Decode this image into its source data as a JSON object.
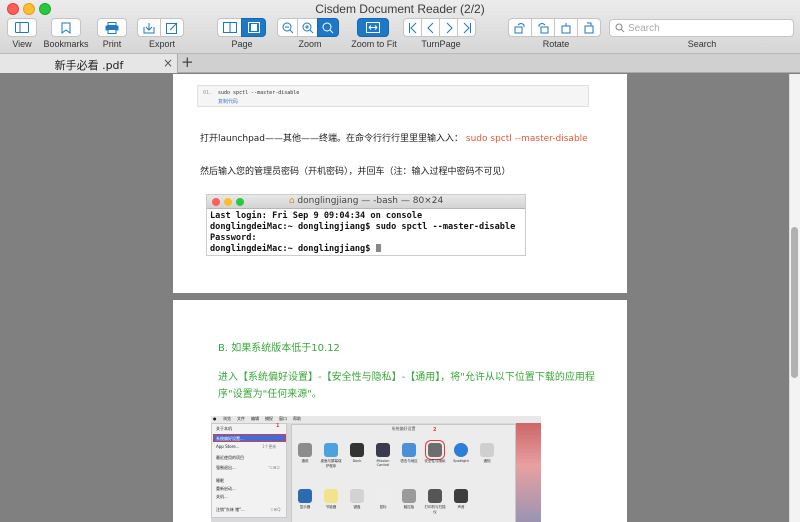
{
  "window": {
    "title": "Cisdem Document Reader (2/2)"
  },
  "toolbar": {
    "view": "View",
    "bookmarks": "Bookmarks",
    "print": "Print",
    "export": "Export",
    "page": "Page",
    "zoom": "Zoom",
    "zoom_to_fit": "Zoom to Fit",
    "turn_page": "TurnPage",
    "rotate": "Rotate",
    "search": "Search",
    "search_placeholder": "Search"
  },
  "tab": {
    "title": "新手必看 .pdf",
    "close": "×",
    "add": "+"
  },
  "page1": {
    "code_num": "01.",
    "code_text": "sudo spctl --master-disable",
    "code_copy": "复制代码",
    "line1_text": "打开launchpad——其他——终端。在命令行行行里里里输入入：",
    "line1_cmd": "sudo spctl --master-disable",
    "line2": "然后输入您的管理员密码（开机密码），并回车（注：输入过程中密码不可见）",
    "terminal": {
      "title": "donglingjiang — -bash — 80×24",
      "lines": [
        "Last login: Fri Sep  9 09:04:34 on console",
        "donglingdeiMac:~ donglingjiang$ sudo spctl --master-disable",
        "Password:",
        "donglingdeiMac:~ donglingjiang$ "
      ]
    }
  },
  "page2": {
    "heading": "B. 如果系统版本低于10.12",
    "para_line1": "进入【系统偏好设置】-【安全性与隐私】-【通用】，将\"允许从以下位置下载的应用程",
    "para_line2": "序\"设置为\"任何来源\"。",
    "screenshot": {
      "menubar": [
        "浏览",
        "文件",
        "编辑",
        "捕捉",
        "窗口",
        "帮助"
      ],
      "menu_items": [
        "关于本机",
        "系统偏好设置...",
        "App Store...",
        "最近使用的项目",
        "强制退出...",
        "睡眠",
        "重新启动...",
        "关机...",
        "注销\"东林 猪\"..."
      ],
      "menu_shortcuts": [
        "1个更新",
        "⌥⌘⎋",
        "⇧⌘Q"
      ],
      "marker1": "1",
      "marker2": "2",
      "prefs_title": "系统偏好设置",
      "row1_labels": [
        "通用",
        "桌面与屏幕保护程序",
        "Dock",
        "Mission Control",
        "语言与地区",
        "安全性与隐私",
        "Spotlight",
        "通知"
      ],
      "row2_labels": [
        "显示器",
        "节能器",
        "键盘",
        "鼠标",
        "触控板",
        "打印机与扫描仪",
        "声音"
      ]
    }
  },
  "colors": {
    "accent": "#1e78c8",
    "command_red": "#e25a3a",
    "heading_green": "#39a83a"
  }
}
